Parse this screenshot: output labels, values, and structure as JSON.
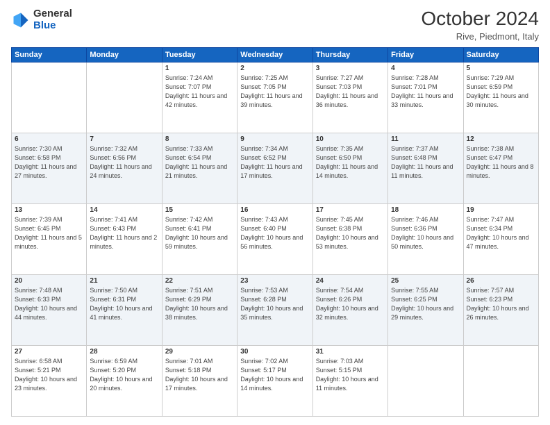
{
  "header": {
    "logo_general": "General",
    "logo_blue": "Blue",
    "month_title": "October 2024",
    "subtitle": "Rive, Piedmont, Italy"
  },
  "days_of_week": [
    "Sunday",
    "Monday",
    "Tuesday",
    "Wednesday",
    "Thursday",
    "Friday",
    "Saturday"
  ],
  "weeks": [
    [
      {
        "day": "",
        "info": ""
      },
      {
        "day": "",
        "info": ""
      },
      {
        "day": "1",
        "info": "Sunrise: 7:24 AM\nSunset: 7:07 PM\nDaylight: 11 hours and 42 minutes."
      },
      {
        "day": "2",
        "info": "Sunrise: 7:25 AM\nSunset: 7:05 PM\nDaylight: 11 hours and 39 minutes."
      },
      {
        "day": "3",
        "info": "Sunrise: 7:27 AM\nSunset: 7:03 PM\nDaylight: 11 hours and 36 minutes."
      },
      {
        "day": "4",
        "info": "Sunrise: 7:28 AM\nSunset: 7:01 PM\nDaylight: 11 hours and 33 minutes."
      },
      {
        "day": "5",
        "info": "Sunrise: 7:29 AM\nSunset: 6:59 PM\nDaylight: 11 hours and 30 minutes."
      }
    ],
    [
      {
        "day": "6",
        "info": "Sunrise: 7:30 AM\nSunset: 6:58 PM\nDaylight: 11 hours and 27 minutes."
      },
      {
        "day": "7",
        "info": "Sunrise: 7:32 AM\nSunset: 6:56 PM\nDaylight: 11 hours and 24 minutes."
      },
      {
        "day": "8",
        "info": "Sunrise: 7:33 AM\nSunset: 6:54 PM\nDaylight: 11 hours and 21 minutes."
      },
      {
        "day": "9",
        "info": "Sunrise: 7:34 AM\nSunset: 6:52 PM\nDaylight: 11 hours and 17 minutes."
      },
      {
        "day": "10",
        "info": "Sunrise: 7:35 AM\nSunset: 6:50 PM\nDaylight: 11 hours and 14 minutes."
      },
      {
        "day": "11",
        "info": "Sunrise: 7:37 AM\nSunset: 6:48 PM\nDaylight: 11 hours and 11 minutes."
      },
      {
        "day": "12",
        "info": "Sunrise: 7:38 AM\nSunset: 6:47 PM\nDaylight: 11 hours and 8 minutes."
      }
    ],
    [
      {
        "day": "13",
        "info": "Sunrise: 7:39 AM\nSunset: 6:45 PM\nDaylight: 11 hours and 5 minutes."
      },
      {
        "day": "14",
        "info": "Sunrise: 7:41 AM\nSunset: 6:43 PM\nDaylight: 11 hours and 2 minutes."
      },
      {
        "day": "15",
        "info": "Sunrise: 7:42 AM\nSunset: 6:41 PM\nDaylight: 10 hours and 59 minutes."
      },
      {
        "day": "16",
        "info": "Sunrise: 7:43 AM\nSunset: 6:40 PM\nDaylight: 10 hours and 56 minutes."
      },
      {
        "day": "17",
        "info": "Sunrise: 7:45 AM\nSunset: 6:38 PM\nDaylight: 10 hours and 53 minutes."
      },
      {
        "day": "18",
        "info": "Sunrise: 7:46 AM\nSunset: 6:36 PM\nDaylight: 10 hours and 50 minutes."
      },
      {
        "day": "19",
        "info": "Sunrise: 7:47 AM\nSunset: 6:34 PM\nDaylight: 10 hours and 47 minutes."
      }
    ],
    [
      {
        "day": "20",
        "info": "Sunrise: 7:48 AM\nSunset: 6:33 PM\nDaylight: 10 hours and 44 minutes."
      },
      {
        "day": "21",
        "info": "Sunrise: 7:50 AM\nSunset: 6:31 PM\nDaylight: 10 hours and 41 minutes."
      },
      {
        "day": "22",
        "info": "Sunrise: 7:51 AM\nSunset: 6:29 PM\nDaylight: 10 hours and 38 minutes."
      },
      {
        "day": "23",
        "info": "Sunrise: 7:53 AM\nSunset: 6:28 PM\nDaylight: 10 hours and 35 minutes."
      },
      {
        "day": "24",
        "info": "Sunrise: 7:54 AM\nSunset: 6:26 PM\nDaylight: 10 hours and 32 minutes."
      },
      {
        "day": "25",
        "info": "Sunrise: 7:55 AM\nSunset: 6:25 PM\nDaylight: 10 hours and 29 minutes."
      },
      {
        "day": "26",
        "info": "Sunrise: 7:57 AM\nSunset: 6:23 PM\nDaylight: 10 hours and 26 minutes."
      }
    ],
    [
      {
        "day": "27",
        "info": "Sunrise: 6:58 AM\nSunset: 5:21 PM\nDaylight: 10 hours and 23 minutes."
      },
      {
        "day": "28",
        "info": "Sunrise: 6:59 AM\nSunset: 5:20 PM\nDaylight: 10 hours and 20 minutes."
      },
      {
        "day": "29",
        "info": "Sunrise: 7:01 AM\nSunset: 5:18 PM\nDaylight: 10 hours and 17 minutes."
      },
      {
        "day": "30",
        "info": "Sunrise: 7:02 AM\nSunset: 5:17 PM\nDaylight: 10 hours and 14 minutes."
      },
      {
        "day": "31",
        "info": "Sunrise: 7:03 AM\nSunset: 5:15 PM\nDaylight: 10 hours and 11 minutes."
      },
      {
        "day": "",
        "info": ""
      },
      {
        "day": "",
        "info": ""
      }
    ]
  ]
}
